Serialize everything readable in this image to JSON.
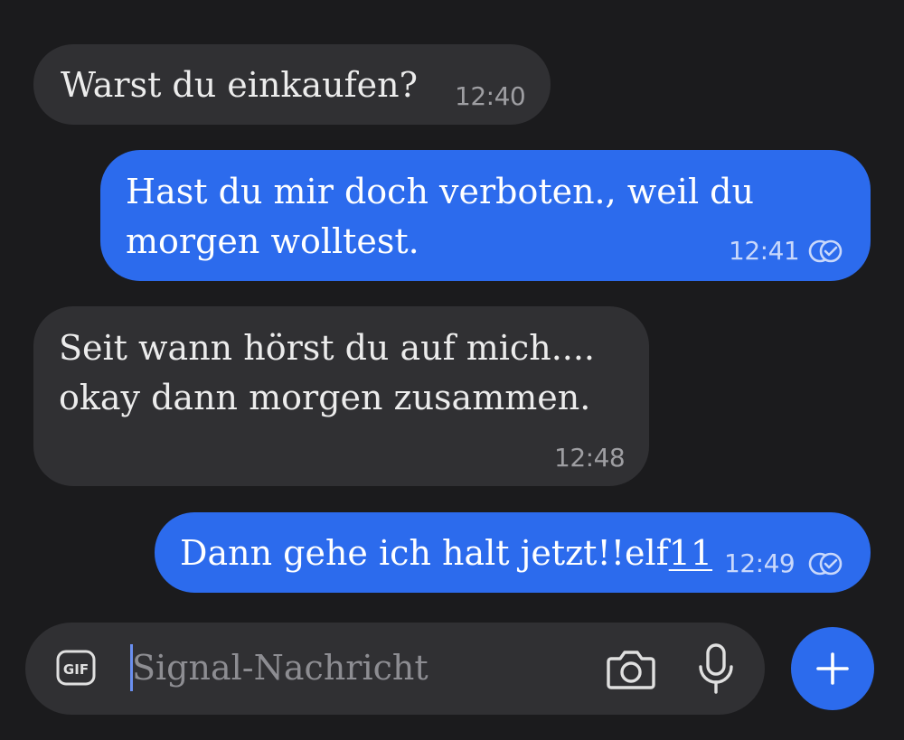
{
  "messages": [
    {
      "direction": "incoming",
      "lines": [
        "Warst du einkaufen?"
      ],
      "time": "12:40"
    },
    {
      "direction": "outgoing",
      "lines": [
        "Hast du mir doch verboten., weil du",
        "morgen wolltest."
      ],
      "time": "12:41",
      "receipt": "read-receipt-icon"
    },
    {
      "direction": "incoming",
      "lines": [
        "Seit wann hörst du auf mich....",
        "okay dann morgen zusammen."
      ],
      "time": "12:48"
    },
    {
      "direction": "outgoing",
      "text_main": "Dann gehe ich halt jetzt!!elf",
      "text_underlined": "11",
      "time": "12:49",
      "receipt": "read-receipt-icon"
    }
  ],
  "composer": {
    "placeholder": "Signal-Nachricht",
    "value": "",
    "gif_icon": "gif-icon",
    "camera_icon": "camera-icon",
    "mic_icon": "microphone-icon",
    "send_icon": "plus-icon"
  },
  "colors": {
    "background": "#1b1b1d",
    "incoming_bubble": "#303033",
    "outgoing_bubble": "#2c6bed",
    "text": "#ececec",
    "timestamp": "#9e9ea2"
  }
}
